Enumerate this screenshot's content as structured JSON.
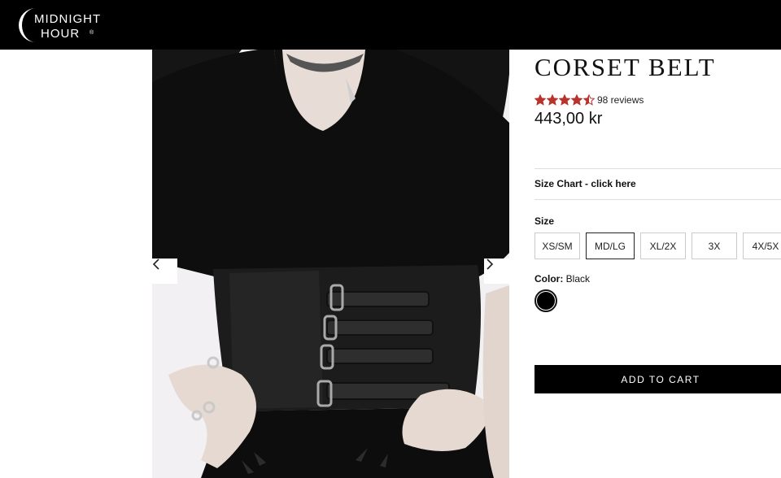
{
  "header": {
    "logo_line1": "MIDNIGHT",
    "logo_line2": "HOUR",
    "logo_reg": "®"
  },
  "gallery": {
    "prev_icon": "chevron-left-icon",
    "next_icon": "chevron-right-icon"
  },
  "product": {
    "title": "CORSET BELT",
    "rating": 4.5,
    "reviews_text": "98 reviews",
    "price": "443,00 kr",
    "size_chart_link": "Size Chart - click here",
    "size_label": "Size",
    "sizes": [
      "XS/SM",
      "MD/LG",
      "XL/2X",
      "3X",
      "4X/5X"
    ],
    "selected_size": "MD/LG",
    "color_label": "Color:",
    "color_value": "Black",
    "add_to_cart": "ADD TO CART"
  },
  "colors": {
    "star": "#b8332b",
    "header_bg": "#000000",
    "swatch": "#000000"
  }
}
